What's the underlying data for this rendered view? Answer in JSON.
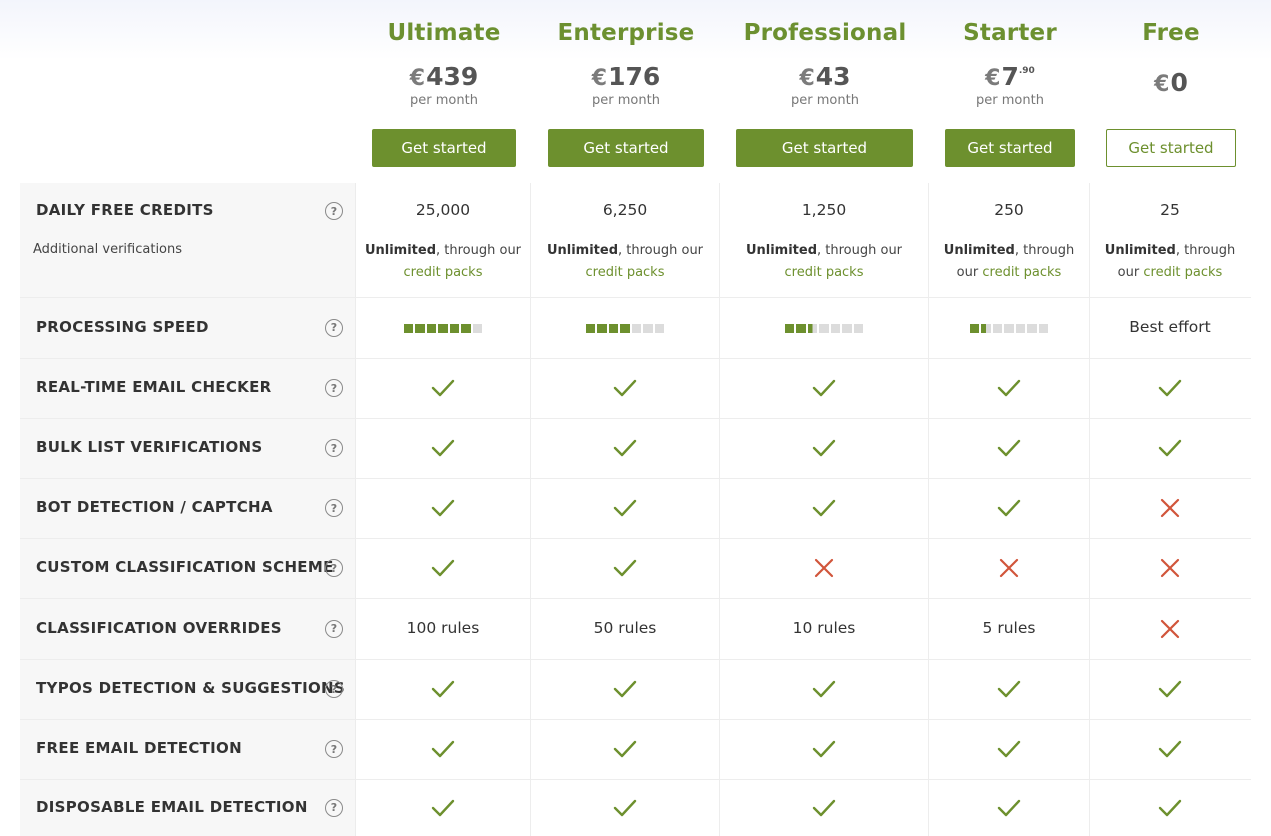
{
  "plans": [
    {
      "name": "Ultimate",
      "currency": "€",
      "price": "439",
      "cents": "",
      "period": "per month",
      "cta": "Get started",
      "style": "solid"
    },
    {
      "name": "Enterprise",
      "currency": "€",
      "price": "176",
      "cents": "",
      "period": "per month",
      "cta": "Get started",
      "style": "solid"
    },
    {
      "name": "Professional",
      "currency": "€",
      "price": "43",
      "cents": "",
      "period": "per month",
      "cta": "Get started",
      "style": "solid"
    },
    {
      "name": "Starter",
      "currency": "€",
      "price": "7",
      "cents": ".90",
      "period": "per month",
      "cta": "Get started",
      "style": "solid"
    },
    {
      "name": "Free",
      "currency": "€",
      "price": "0",
      "cents": "",
      "period": "",
      "cta": "Get started",
      "style": "outline"
    }
  ],
  "colors": {
    "accent": "#6d902e",
    "cross": "#d1553b",
    "label_bg": "#f7f7f7"
  },
  "features": [
    {
      "label": "DAILY FREE CREDITS",
      "sub_label": "Additional verifications",
      "values": [
        "25,000",
        "6,250",
        "1,250",
        "250",
        "25"
      ],
      "extras": [
        {
          "strong": "Unlimited",
          "mid": ", through our",
          "link": "credit packs"
        },
        {
          "strong": "Unlimited",
          "mid": ", through our",
          "link": "credit packs"
        },
        {
          "strong": "Unlimited",
          "mid": ", through our",
          "link": "credit packs"
        },
        {
          "strong": "Unlimited",
          "mid": ", through our",
          "link": "credit packs"
        },
        {
          "strong": "Unlimited",
          "mid": ", through our",
          "link": "credit packs"
        }
      ]
    },
    {
      "label": "PROCESSING SPEED",
      "type": "speed",
      "speed_levels": [
        6,
        4,
        2.5,
        1.5,
        null
      ],
      "speed_max": 7,
      "fallback_text": "Best effort"
    },
    {
      "label": "REAL-TIME EMAIL CHECKER",
      "values": [
        "check",
        "check",
        "check",
        "check",
        "check"
      ]
    },
    {
      "label": "BULK LIST VERIFICATIONS",
      "values": [
        "check",
        "check",
        "check",
        "check",
        "check"
      ]
    },
    {
      "label": "BOT DETECTION / CAPTCHA",
      "values": [
        "check",
        "check",
        "check",
        "check",
        "cross"
      ]
    },
    {
      "label": "CUSTOM CLASSIFICATION SCHEME",
      "values": [
        "check",
        "check",
        "cross",
        "cross",
        "cross"
      ]
    },
    {
      "label": "CLASSIFICATION OVERRIDES",
      "values": [
        "100 rules",
        "50 rules",
        "10 rules",
        "5 rules",
        "cross"
      ]
    },
    {
      "label": "TYPOS DETECTION & SUGGESTIONS",
      "values": [
        "check",
        "check",
        "check",
        "check",
        "check"
      ]
    },
    {
      "label": "FREE EMAIL DETECTION",
      "values": [
        "check",
        "check",
        "check",
        "check",
        "check"
      ]
    },
    {
      "label": "DISPOSABLE EMAIL DETECTION",
      "values": [
        "check",
        "check",
        "check",
        "check",
        "check"
      ]
    }
  ],
  "icons": {
    "help": "question-circle-icon",
    "check": "check-icon",
    "cross": "cross-icon"
  },
  "help_glyph": "?"
}
